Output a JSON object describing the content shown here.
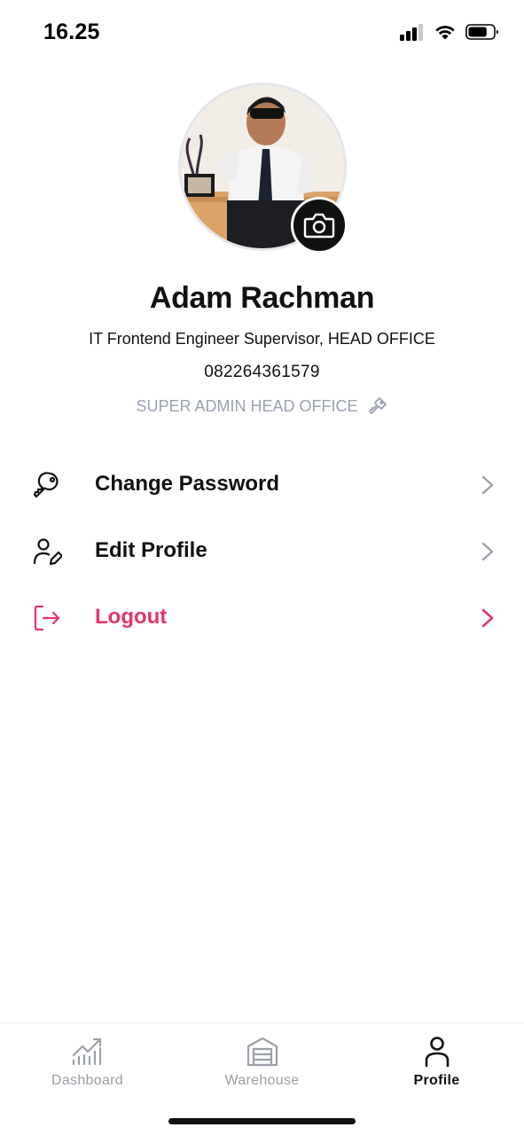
{
  "status_bar": {
    "time": "16.25",
    "battery_level": 0.75
  },
  "profile": {
    "name": "Adam Rachman",
    "position": "IT Frontend Engineer Supervisor, HEAD OFFICE",
    "phone": "082264361579",
    "role": "SUPER ADMIN HEAD OFFICE",
    "role_icon": "key-icon",
    "camera_icon": "camera-icon"
  },
  "menu": {
    "items": [
      {
        "label": "Change Password",
        "icon": "key-icon",
        "color": "#111111"
      },
      {
        "label": "Edit Profile",
        "icon": "user-edit-icon",
        "color": "#111111"
      },
      {
        "label": "Logout",
        "icon": "logout-icon",
        "color": "#e5356a"
      }
    ]
  },
  "bottom_nav": {
    "items": [
      {
        "label": "Dashboard",
        "icon": "chart-icon",
        "active": false
      },
      {
        "label": "Warehouse",
        "icon": "warehouse-icon",
        "active": false
      },
      {
        "label": "Profile",
        "icon": "user-icon",
        "active": true
      }
    ]
  },
  "colors": {
    "accent_danger": "#e5356a",
    "muted": "#9aa2b1",
    "text": "#111111"
  }
}
